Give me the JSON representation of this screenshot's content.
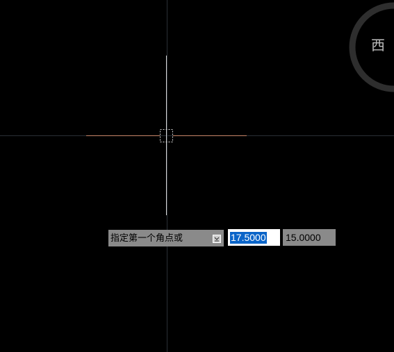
{
  "canvas": {
    "background": "#000000",
    "axis_color": "#2a2f36",
    "cursor_color": "#d8d8d8",
    "cursor_accent_color": "#c9866a"
  },
  "dynamic_input": {
    "prompt": "指定第一个角点或",
    "options_icon": "dropdown-arrow-icon",
    "x_value": "17.5000",
    "y_value": "15.0000",
    "x_field_color": "#ffffff",
    "selection_color": "#0a64c8",
    "field_color": "#8a8a8a"
  },
  "viewcube": {
    "label": "西",
    "ring_color": "#2e2e2e"
  }
}
